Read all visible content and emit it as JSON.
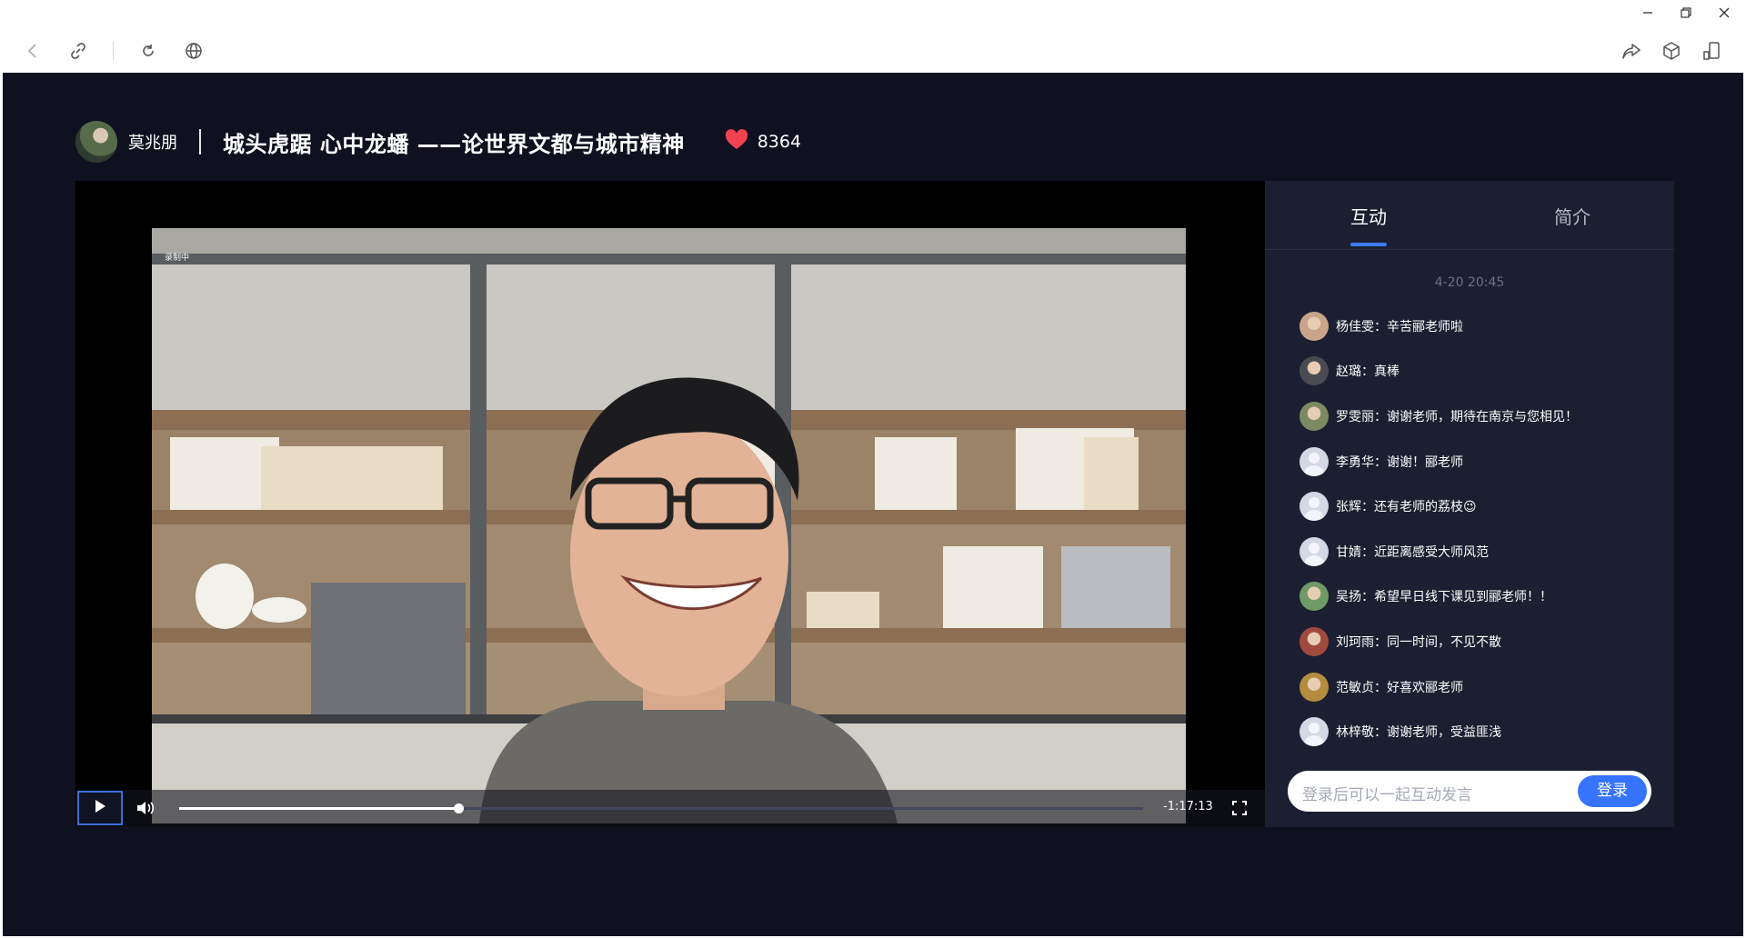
{
  "header": {
    "host_name": "莫兆朋",
    "title": "城头虎踞 心中龙蟠 ——论世界文都与城市精神",
    "likes": "8364"
  },
  "player": {
    "time_remaining": "-1:17:13",
    "progress": 0.29,
    "overlay_text": "录制中"
  },
  "side": {
    "tabs": [
      {
        "label": "互动"
      },
      {
        "label": "简介"
      }
    ],
    "timestamp": "4-20 20:45",
    "messages": [
      {
        "text": "杨佳雯：辛苦郦老师啦",
        "avatar": "photo"
      },
      {
        "text": "赵璐：真棒",
        "avatar": "photo"
      },
      {
        "text": "罗雯丽：谢谢老师，期待在南京与您相见！",
        "avatar": "photo"
      },
      {
        "text": "李勇华：谢谢！郦老师",
        "avatar": "blank"
      },
      {
        "text": "张辉：还有老师的荔枝😉",
        "avatar": "blank"
      },
      {
        "text": "甘婧：近距离感受大师风范",
        "avatar": "blank"
      },
      {
        "text": "吴扬：希望早日线下课见到郦老师！！",
        "avatar": "photo"
      },
      {
        "text": "刘珂雨：同一时间，不见不散",
        "avatar": "photo"
      },
      {
        "text": "范敏贞：好喜欢郦老师",
        "avatar": "photo"
      },
      {
        "text": "林梓敬：谢谢老师，受益匪浅",
        "avatar": "blank"
      }
    ],
    "input_placeholder": "登录后可以一起互动发言",
    "login_label": "登录"
  },
  "colors": {
    "page_bg": "#0f1120",
    "panel_bg": "#1b1f31",
    "accent": "#3673ff",
    "heart": "#f0434f"
  },
  "icons": [
    "back-icon",
    "link-icon",
    "refresh-icon",
    "globe-icon",
    "share-icon",
    "cube-icon",
    "phone-icon",
    "minimize-icon",
    "restore-icon",
    "close-icon",
    "heart-icon",
    "play-icon",
    "volume-icon",
    "fullscreen-icon"
  ]
}
